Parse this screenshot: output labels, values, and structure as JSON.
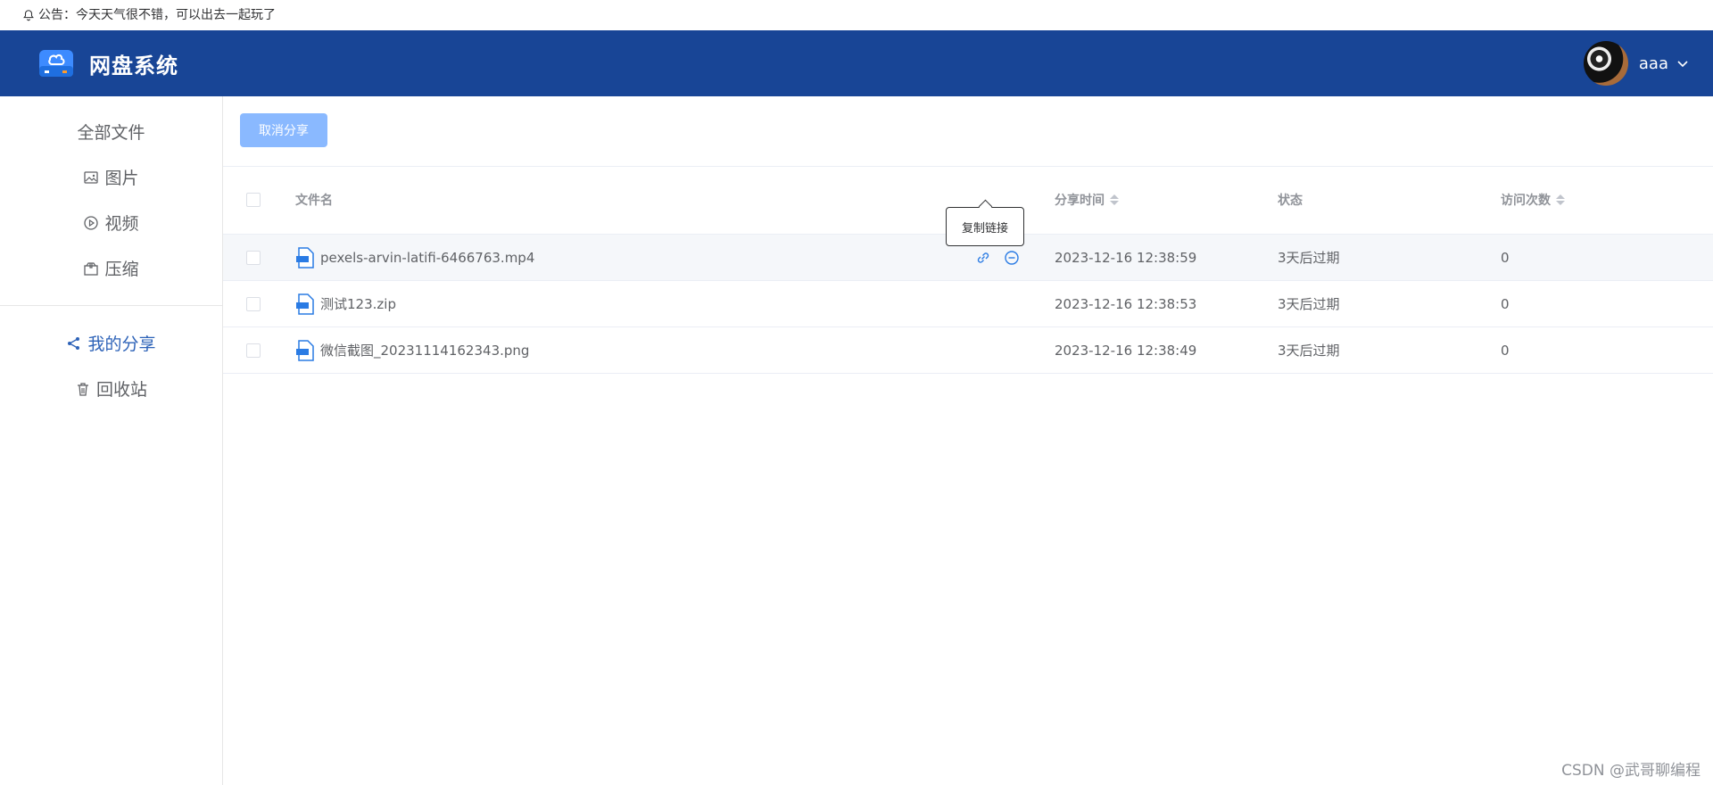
{
  "notice": {
    "text": "公告：今天天气很不错，可以出去一起玩了"
  },
  "header": {
    "title": "网盘系统",
    "username": "aaa"
  },
  "sidebar": {
    "items": [
      {
        "label": "全部文件"
      },
      {
        "label": "图片"
      },
      {
        "label": "视频"
      },
      {
        "label": "压缩"
      }
    ],
    "items2": [
      {
        "label": "我的分享",
        "active": true
      },
      {
        "label": "回收站"
      }
    ]
  },
  "toolbar": {
    "cancel_share_label": "取消分享"
  },
  "table": {
    "headers": {
      "filename": "文件名",
      "share_time": "分享时间",
      "status": "状态",
      "visits": "访问次数"
    },
    "rows": [
      {
        "name": "pexels-arvin-latifi-6466763.mp4",
        "time": "2023-12-16 12:38:59",
        "status": "3天后过期",
        "visits": "0"
      },
      {
        "name": "测试123.zip",
        "time": "2023-12-16 12:38:53",
        "status": "3天后过期",
        "visits": "0"
      },
      {
        "name": "微信截图_20231114162343.png",
        "time": "2023-12-16 12:38:49",
        "status": "3天后过期",
        "visits": "0"
      }
    ]
  },
  "tooltip": {
    "text": "复制链接"
  },
  "watermark": {
    "text": "CSDN @武哥聊编程"
  },
  "colors": {
    "header_bg": "#184596",
    "accent": "#2e63b8",
    "button_bg": "#8ab9ff"
  }
}
